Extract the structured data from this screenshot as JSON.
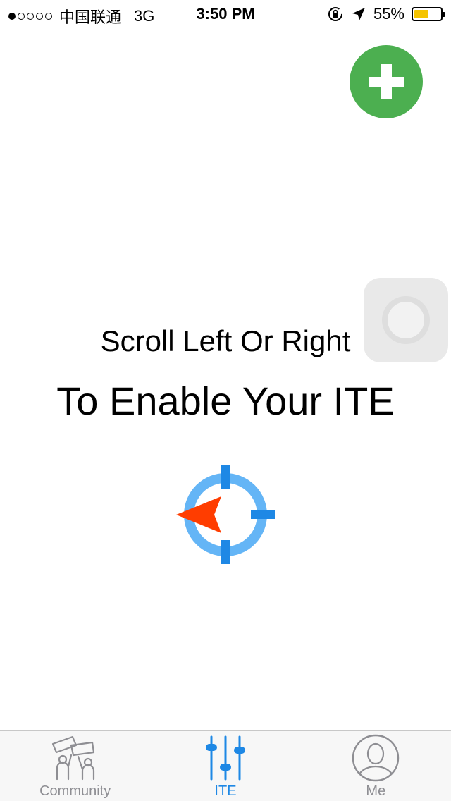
{
  "status_bar": {
    "signal_dots_filled": 1,
    "signal_dots_total": 5,
    "carrier": "中国联通",
    "network": "3G",
    "time": "3:50 PM",
    "battery_percent": "55%",
    "battery_level": 0.55,
    "icons": [
      "rotation-lock-icon",
      "location-arrow-icon"
    ]
  },
  "add_button": {
    "icon": "plus-icon",
    "color": "#4caf50"
  },
  "instructions": {
    "line1": "Scroll Left Or Right",
    "line2": "To Enable Your ITE"
  },
  "target_icon": {
    "icon": "crosshair-target-icon",
    "ring_color": "#64b5f6",
    "tick_color": "#1e88e5",
    "arrow_color": "#ff3d00"
  },
  "tab_bar": {
    "tabs": [
      {
        "label": "Community",
        "icon": "community-icon",
        "active": false
      },
      {
        "label": "ITE",
        "icon": "sliders-icon",
        "active": true
      },
      {
        "label": "Me",
        "icon": "profile-icon",
        "active": false
      }
    ],
    "active_color": "#1e88e5",
    "inactive_color": "#8e8e93"
  }
}
